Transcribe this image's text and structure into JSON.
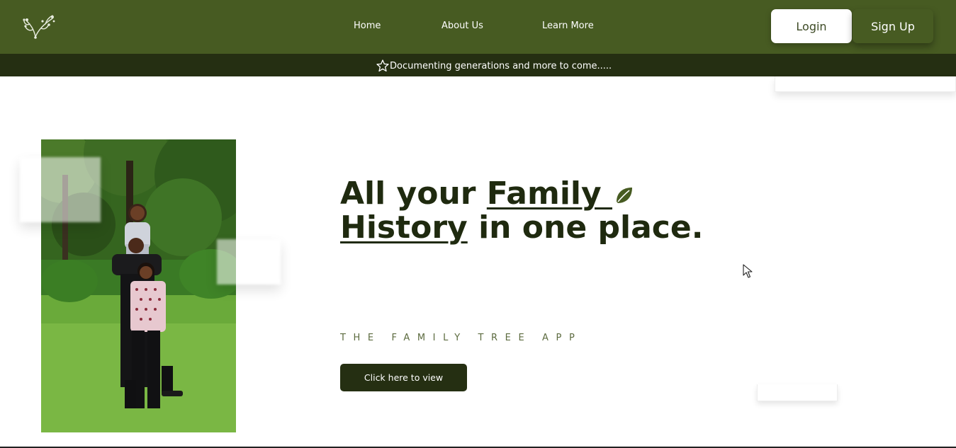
{
  "nav": {
    "links": [
      "Home",
      "About Us",
      "Learn More"
    ],
    "login_label": "Login",
    "signup_label": "Sign Up"
  },
  "banner": {
    "text": "Documenting generations and more to come....."
  },
  "hero": {
    "headline_pre": "All your ",
    "headline_u1": "Family ",
    "headline_u2": "History",
    "headline_post": " in one place.",
    "tagline": "THE FAMILY TREE APP",
    "cta_label": "Click here to view"
  },
  "colors": {
    "nav_bg": "#475b22",
    "banner_bg": "#252f12",
    "headline": "#1f2a0f",
    "tagline": "#5c6b3f",
    "cta_bg": "#252f12"
  },
  "icons": [
    "tree-logo-icon",
    "star-icon",
    "leaf-icon",
    "mouse-cursor-icon"
  ]
}
